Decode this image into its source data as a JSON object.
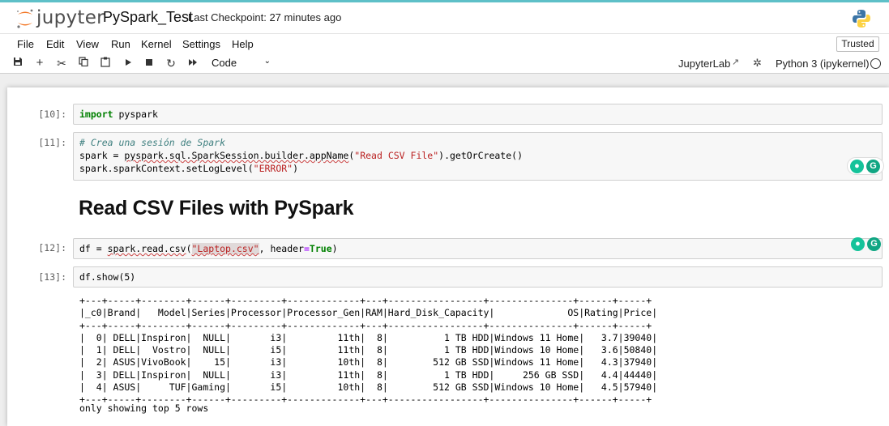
{
  "header": {
    "logo_text": "jupyter",
    "notebook_title": "PySpark_Test",
    "checkpoint": "Last Checkpoint: 27 minutes ago"
  },
  "menu": {
    "items": [
      "File",
      "Edit",
      "View",
      "Run",
      "Kernel",
      "Settings",
      "Help"
    ],
    "trusted": "Trusted"
  },
  "toolbar": {
    "icons": [
      "save-icon",
      "add-cell-icon",
      "cut-icon",
      "copy-icon",
      "paste-icon",
      "run-icon",
      "stop-icon",
      "restart-icon",
      "fast-forward-icon"
    ],
    "cell_type": "Code",
    "jupyterlab": "JupyterLab",
    "kernel": "Python 3 (ipykernel)"
  },
  "cells": {
    "c10": {
      "prompt": "[10]:"
    },
    "c11": {
      "prompt": "[11]:"
    },
    "heading": "Read CSV Files with PySpark",
    "c12": {
      "prompt": "[12]:"
    },
    "c13": {
      "prompt": "[13]:"
    }
  },
  "code": {
    "c10_l1_kw": "import",
    "c10_l1_rest": " pyspark",
    "c11_l1": "# Crea una sesión de Spark",
    "c11_l2_a": "spark = ",
    "c11_l2_b": "pyspark.sql.SparkSession.builder.appName",
    "c11_l2_c": "(",
    "c11_l2_str": "\"Read CSV File\"",
    "c11_l2_d": ").getOrCreate()",
    "c11_l3_a": "spark.sparkContext.setLogLevel(",
    "c11_l3_str": "\"ERROR\"",
    "c11_l3_b": ")",
    "c12_a": "df = ",
    "c12_b": "spark.read.csv",
    "c12_c": "(",
    "c12_str": "\"Laptop.csv\"",
    "c12_d": ", header",
    "c12_eq": "=",
    "c12_kw": "True",
    "c12_e": ")",
    "c13_l1": "df.show(5)"
  },
  "output": {
    "table": "+---+-----+--------+------+---------+-------------+---+-----------------+---------------+------+-----+\n|_c0|Brand|   Model|Series|Processor|Processor_Gen|RAM|Hard_Disk_Capacity|             OS|Rating|Price|\n+---+-----+--------+------+---------+-------------+---+-----------------+---------------+------+-----+\n|  0| DELL|Inspiron|  NULL|       i3|         11th|  8|          1 TB HDD|Windows 11 Home|   3.7|39040|\n|  1| DELL|  Vostro|  NULL|       i5|         11th|  8|          1 TB HDD|Windows 10 Home|   3.6|50840|\n|  2| ASUS|VivoBook|    15|       i3|         10th|  8|        512 GB SSD|Windows 11 Home|   4.3|37940|\n|  3| DELL|Inspiron|  NULL|       i3|         11th|  8|          1 TB HDD|     256 GB SSD|   4.4|44440|\n|  4| ASUS|     TUF|Gaming|       i5|         10th|  8|        512 GB SSD|Windows 10 Home|   4.5|57940|\n+---+-----+--------+------+---------+-------------+---+-----------------+---------------+------+-----+",
    "footer": "only showing top 5 rows"
  },
  "colors": {
    "accent": "#5ec0c8",
    "grammarly": "#15c39a"
  }
}
